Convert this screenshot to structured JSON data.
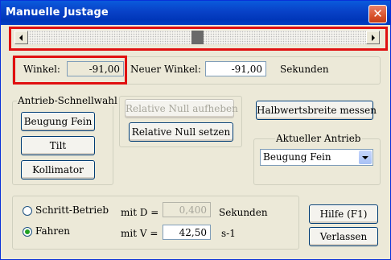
{
  "window": {
    "title": "Manuelle Justage",
    "close_glyph": "✕"
  },
  "angle": {
    "label": "Winkel:",
    "value": "-91,00",
    "new_label": "Neuer Winkel:",
    "new_value": "-91,00",
    "unit": "Sekunden"
  },
  "scrollbar": {
    "position_fraction": 0.5
  },
  "drive_quick": {
    "legend": "Antrieb-Schnellwahl",
    "buttons": [
      "Beugung Fein",
      "Tilt",
      "Kollimator"
    ]
  },
  "relative_null": {
    "cancel_label": "Relative Null aufheben",
    "set_label": "Relative Null setzen"
  },
  "halfwidth_label": "Halbwertsbreite messen",
  "current_drive": {
    "legend": "Aktueller Antrieb",
    "selected": "Beugung Fein"
  },
  "mode": {
    "step_label": "Schritt-Betrieb",
    "step_param_label": "mit D =",
    "step_value": "0,400",
    "step_unit": "Sekunden",
    "drive_label": "Fahren",
    "drive_param_label": "mit V =",
    "drive_value": "42,50",
    "drive_unit": "s-1",
    "selected": "Fahren"
  },
  "buttons": {
    "help": "Hilfe (F1)",
    "exit": "Verlassen"
  },
  "colors": {
    "highlight": "#e01010",
    "title_bar": "#0841c7"
  }
}
